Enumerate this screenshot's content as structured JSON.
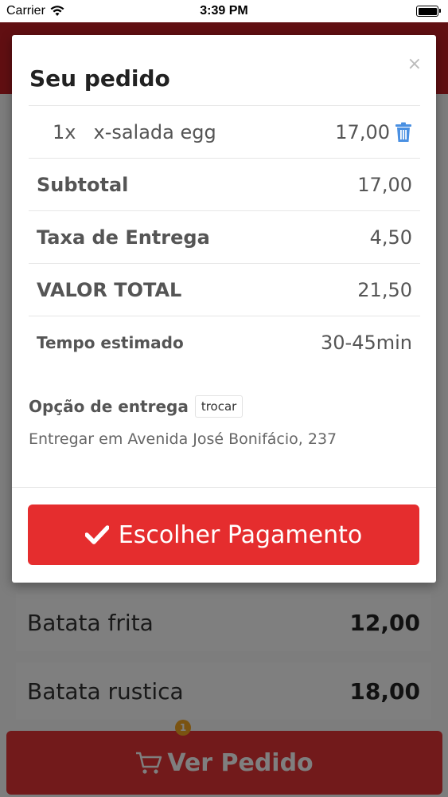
{
  "status_bar": {
    "carrier": "Carrier",
    "time": "3:39 PM"
  },
  "background": {
    "menu_items": [
      {
        "name": "Batata frita",
        "price": "12,00"
      },
      {
        "name": "Batata rustica",
        "price": "18,00"
      }
    ],
    "cart_button": {
      "label": "Ver Pedido",
      "badge_count": "1"
    }
  },
  "modal": {
    "title": "Seu pedido",
    "close_label": "×",
    "item": {
      "qty": "1x",
      "name": "x-salada egg",
      "price": "17,00"
    },
    "subtotal": {
      "label": "Subtotal",
      "value": "17,00"
    },
    "delivery_fee": {
      "label": "Taxa de Entrega",
      "value": "4,50"
    },
    "total": {
      "label": "VALOR TOTAL",
      "value": "21,50"
    },
    "estimated_time": {
      "label": "Tempo estimado",
      "value": "30-45min"
    },
    "delivery_option": {
      "label": "Opção de entrega",
      "change_label": "trocar",
      "address": "Entregar em Avenida José Bonifácio, 237"
    },
    "pay_button": {
      "label": "Escolher Pagamento"
    }
  },
  "colors": {
    "brand_red": "#c21f24",
    "button_red": "#e52d2e",
    "trash_blue": "#4a90e2",
    "badge_orange": "#f5a623"
  },
  "icons": [
    "wifi-icon",
    "battery-icon",
    "close-icon",
    "trash-icon",
    "check-icon",
    "cart-icon"
  ]
}
